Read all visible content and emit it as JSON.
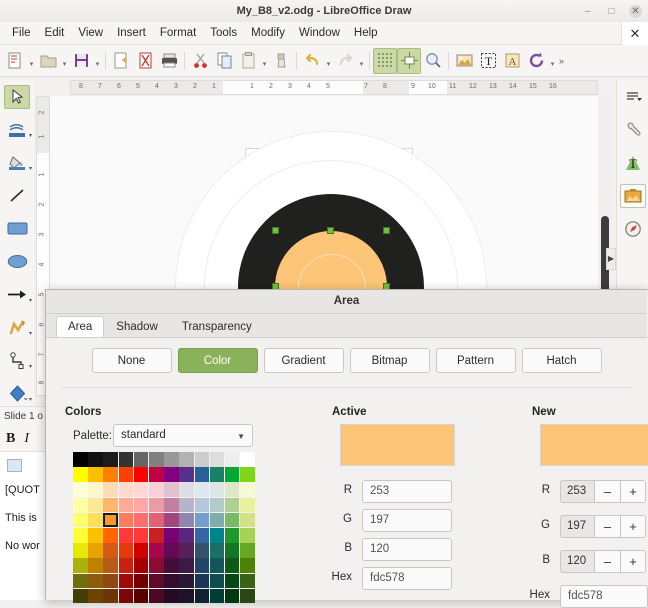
{
  "window": {
    "title": "My_B8_v2.odg - LibreOffice Draw",
    "minimize": "–",
    "maximize": "□",
    "close": "✕"
  },
  "menubar": {
    "items": [
      "File",
      "Edit",
      "View",
      "Insert",
      "Format",
      "Tools",
      "Modify",
      "Window",
      "Help"
    ],
    "close_doc": "✕"
  },
  "toolbar": {
    "overflow": "»",
    "items": [
      {
        "name": "new-document-icon",
        "dropdown": true
      },
      {
        "name": "open-document-icon",
        "dropdown": true
      },
      {
        "name": "save-document-icon",
        "dropdown": true
      },
      {
        "name": "export-pdf-icon",
        "dropdown": false
      },
      {
        "name": "export-directly-as-pdf-icon",
        "dropdown": false
      },
      {
        "name": "print-icon",
        "dropdown": false
      },
      {
        "name": "cut-icon",
        "dropdown": false
      },
      {
        "name": "copy-icon",
        "dropdown": false
      },
      {
        "name": "paste-icon",
        "dropdown": true
      },
      {
        "name": "clone-formatting-icon",
        "dropdown": false
      },
      {
        "name": "undo-icon",
        "dropdown": true
      },
      {
        "name": "redo-icon",
        "dropdown": true
      },
      {
        "name": "display-grid-icon",
        "dropdown": false
      },
      {
        "name": "snap-to-grid-icon",
        "dropdown": false
      },
      {
        "name": "zoom-icon",
        "dropdown": false
      },
      {
        "name": "insert-image-icon",
        "dropdown": false
      },
      {
        "name": "insert-text-box-icon",
        "dropdown": false
      },
      {
        "name": "insert-fontwork-icon",
        "dropdown": false
      },
      {
        "name": "transformations-icon",
        "dropdown": true
      }
    ]
  },
  "left_toolbar": {
    "items": [
      {
        "name": "select-tool",
        "selected": true,
        "dropdown": false
      },
      {
        "name": "zoom-and-pan-tool",
        "selected": false,
        "dropdown": true
      },
      {
        "name": "fill-color-tool",
        "selected": false,
        "dropdown": true
      },
      {
        "name": "line-tool",
        "selected": false,
        "dropdown": false
      },
      {
        "name": "rectangle-tool",
        "selected": false,
        "dropdown": false
      },
      {
        "name": "ellipse-tool",
        "selected": false,
        "dropdown": false
      },
      {
        "name": "line-ends-with-arrow-tool",
        "selected": false,
        "dropdown": true
      },
      {
        "name": "curves-and-polygons-tool",
        "selected": false,
        "dropdown": true
      },
      {
        "name": "connectors-tool",
        "selected": false,
        "dropdown": true
      },
      {
        "name": "basic-shapes-tool",
        "selected": false,
        "dropdown": true
      }
    ],
    "collapse": "⌄"
  },
  "right_sidebar": {
    "items": [
      {
        "name": "sidebar-settings-icon",
        "selected": false
      },
      {
        "name": "properties-icon",
        "selected": false
      },
      {
        "name": "character-styles-icon",
        "selected": false
      },
      {
        "name": "gallery-icon",
        "selected": true
      },
      {
        "name": "navigator-icon",
        "selected": false
      }
    ],
    "show_handle": "▶"
  },
  "rulers": {
    "horizontal": [
      "8",
      "7",
      "6",
      "5",
      "4",
      "3",
      "2",
      "1",
      "1",
      "2",
      "3",
      "4",
      "5",
      "7",
      "8",
      "9",
      "10",
      "11",
      "12",
      "13",
      "14",
      "15",
      "16"
    ],
    "vertical": [
      "2",
      "1",
      "1",
      "2",
      "3",
      "4",
      "5",
      "6",
      "7",
      "8"
    ]
  },
  "status": {
    "slide": "Slide 1 o"
  },
  "background_window": {
    "bold": "B",
    "italic": "I",
    "table_icon": "table-icon",
    "lines": [
      "[QUOT",
      "This is",
      "No wor"
    ]
  },
  "dialog": {
    "title": "Area",
    "tabs": [
      {
        "label": "Area",
        "active": true
      },
      {
        "label": "Shadow",
        "active": false
      },
      {
        "label": "Transparency",
        "active": false
      }
    ],
    "fill_buttons": [
      {
        "label": "None",
        "active": false
      },
      {
        "label": "Color",
        "active": true
      },
      {
        "label": "Gradient",
        "active": false
      },
      {
        "label": "Bitmap",
        "active": false
      },
      {
        "label": "Pattern",
        "active": false
      },
      {
        "label": "Hatch",
        "active": false
      }
    ],
    "colors": {
      "heading": "Colors",
      "palette_label": "Palette:",
      "palette_value": "standard",
      "palette_arrow": "▼",
      "selected_index": 50,
      "swatches": [
        "#000000",
        "#111111",
        "#1c1c1c",
        "#333333",
        "#666666",
        "#808080",
        "#999999",
        "#b2b2b2",
        "#cccccc",
        "#dddddd",
        "#eeeeee",
        "#ffffff",
        "#ffff00",
        "#ffbf00",
        "#ff8000",
        "#ff4000",
        "#ff0000",
        "#bf0041",
        "#800080",
        "#55308d",
        "#2a6099",
        "#158466",
        "#00a933",
        "#81d41a",
        "#ffffd7",
        "#fff5ce",
        "#ffdbb6",
        "#ffd8ce",
        "#ffd7d7",
        "#f7d1d5",
        "#e0c2cd",
        "#dedce6",
        "#dee6ef",
        "#dee7e5",
        "#dde8cb",
        "#f6f9d4",
        "#ffffa6",
        "#ffe994",
        "#ffb66c",
        "#ffaa95",
        "#ffa6a6",
        "#ec9ba4",
        "#bf819e",
        "#b7b3ca",
        "#b4c7dc",
        "#b3cac7",
        "#afd095",
        "#e8f2a1",
        "#ffff6d",
        "#ffde59",
        "#ff972f",
        "#ff7b59",
        "#ff6d6d",
        "#e16173",
        "#a1467e",
        "#8e86ae",
        "#729fcf",
        "#81acac",
        "#77bc65",
        "#d5e187",
        "#ffff38",
        "#ffc000",
        "#ff6600",
        "#ff3838",
        "#ff3838",
        "#c9211e",
        "#780373",
        "#5b277d",
        "#3465a4",
        "#00848a",
        "#1e9a2d",
        "#a9d158",
        "#e6e905",
        "#e8a202",
        "#d45b14",
        "#e8380d",
        "#d00000",
        "#a7074b",
        "#650953",
        "#55215b",
        "#355269",
        "#1c6e66",
        "#127622",
        "#68a723",
        "#acb20c",
        "#bf8100",
        "#b85c14",
        "#c9210e",
        "#a70000",
        "#8d0b32",
        "#470d3a",
        "#3b1a46",
        "#224565",
        "#14565b",
        "#0c5a1a",
        "#51800a",
        "#706e0c",
        "#8b5d0c",
        "#8d4910",
        "#a00a0a",
        "#730000",
        "#5f0a2a",
        "#340d2e",
        "#2a1839",
        "#1b3654",
        "#0d4c4f",
        "#054715",
        "#3b6318",
        "#443d04",
        "#6b4400",
        "#6f3508",
        "#7a0606",
        "#5b0000",
        "#4b0a20",
        "#250a24",
        "#1e1228",
        "#112233",
        "#003c38",
        "#01370e",
        "#2a4612"
      ]
    },
    "active": {
      "heading": "Active",
      "swatch_hex": "#fdc578",
      "r_label": "R",
      "r_value": "253",
      "g_label": "G",
      "g_value": "197",
      "b_label": "B",
      "b_value": "120",
      "hex_label": "Hex",
      "hex_value": "fdc578"
    },
    "new": {
      "heading": "New",
      "swatch_hex": "#fdc578",
      "r_label": "R",
      "r_value": "253",
      "g_label": "G",
      "g_value": "197",
      "b_label": "B",
      "b_value": "120",
      "hex_label": "Hex",
      "hex_value": "fdc578",
      "minus": "–",
      "plus": "+"
    }
  }
}
